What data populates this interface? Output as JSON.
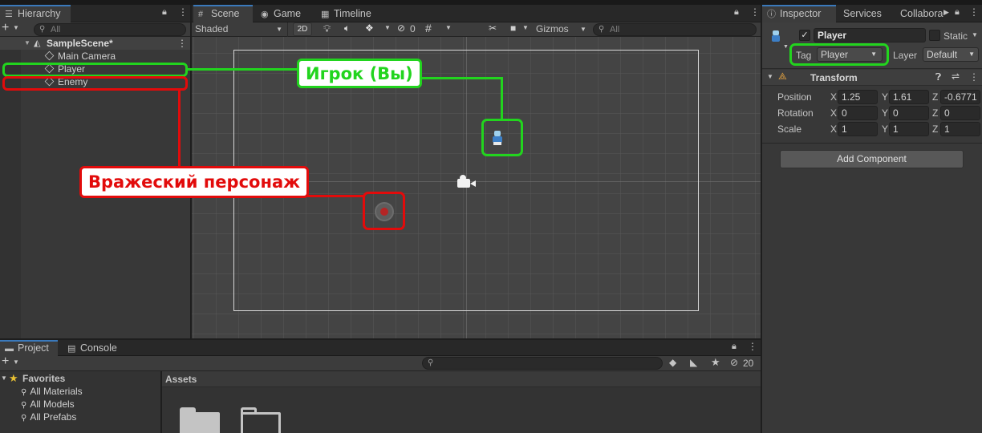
{
  "hierarchy": {
    "tab_label": "Hierarchy",
    "search_placeholder": "All",
    "scene_name": "SampleScene*",
    "items": [
      "Main Camera",
      "Player",
      "Enemy"
    ]
  },
  "scene_tabs": {
    "scene": "Scene",
    "game": "Game",
    "timeline": "Timeline"
  },
  "scene_toolbar": {
    "shading_mode": "Shaded",
    "mode_2d": "2D",
    "hidden_count": "0",
    "gizmos_label": "Gizmos",
    "search_placeholder": "All"
  },
  "annotations": {
    "player_label": "Игрок (Вы)",
    "enemy_label": "Вражеский персонаж",
    "player_color": "#22d41e",
    "enemy_color": "#e20b0b"
  },
  "inspector": {
    "tabs": [
      "Inspector",
      "Services",
      "Collabora"
    ],
    "object_name": "Player",
    "static_label": "Static",
    "tag_label": "Tag",
    "tag_value": "Player",
    "layer_label": "Layer",
    "layer_value": "Default",
    "component_title": "Transform",
    "rows": [
      {
        "label": "Position",
        "x": "1.25",
        "y": "1.61",
        "z": "-0.6771"
      },
      {
        "label": "Rotation",
        "x": "0",
        "y": "0",
        "z": "0"
      },
      {
        "label": "Scale",
        "x": "1",
        "y": "1",
        "z": "1"
      }
    ],
    "axis_x": "X",
    "axis_y": "Y",
    "axis_z": "Z",
    "add_component_label": "Add Component"
  },
  "project": {
    "tabs": [
      "Project",
      "Console"
    ],
    "favorites_label": "Favorites",
    "favorites": [
      "All Materials",
      "All Models",
      "All Prefabs"
    ],
    "assets_label": "Assets",
    "hidden_count": "20"
  },
  "icons": [
    "lock-icon",
    "menu-icon",
    "plus-icon",
    "search-icon",
    "light-icon",
    "audio-icon",
    "effects-icon",
    "visibility-icon",
    "grid-icon",
    "tools-icon",
    "camera-icon",
    "star-icon",
    "folder-icon",
    "gear-icon",
    "help-icon",
    "sliders-icon"
  ]
}
